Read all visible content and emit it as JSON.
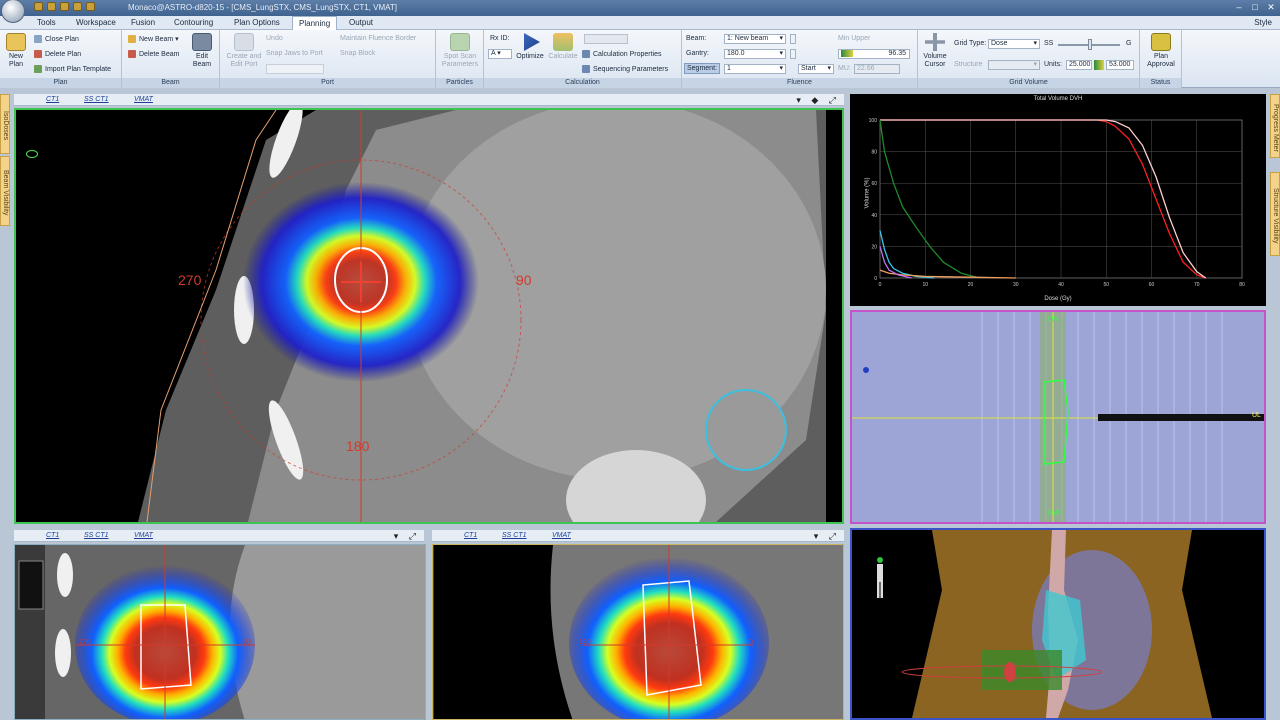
{
  "titlebar": {
    "title": "Monaco@ASTRO-d820-15 - [CMS_LungSTX, CMS_LungSTX, CT1, VMAT]"
  },
  "menu": {
    "items": [
      "Tools",
      "Workspace",
      "Fusion",
      "Contouring",
      "Plan Options",
      "Planning",
      "Output"
    ],
    "active": "Planning",
    "style": "Style"
  },
  "ribbon": {
    "plan": {
      "label": "Plan",
      "new_plan": "New Plan",
      "close_plan": "Close Plan",
      "delete_plan": "Delete Plan",
      "import_template": "Import Plan Template"
    },
    "beam": {
      "label": "Beam",
      "new_beam": "New Beam",
      "delete_beam": "Delete Beam",
      "edit_beam": "Edit Beam"
    },
    "port": {
      "label": "Port",
      "create_edit": "Create and Edit Port",
      "undo": "Undo",
      "snap_jaws": "Snap Jaws to Port",
      "maintain_fluence": "Maintain Fluence Border",
      "snap_block": "Snap Block"
    },
    "particles": {
      "label": "Particles",
      "spot_scan": "Spot Scan Parameters"
    },
    "calculation": {
      "label": "Calculation",
      "rx_id_label": "Rx ID:",
      "rx_id_value": "A",
      "optimize": "Optimize",
      "calculate": "Calculate",
      "calc_props": "Calculation Properties",
      "seq_params": "Sequencing Parameters"
    },
    "fluence": {
      "label": "Fluence",
      "beam_label": "Beam:",
      "beam_value": "1: New beam",
      "gantry_label": "Gantry:",
      "gantry_value": "180.0",
      "segment_label": "Segment:",
      "segment_value": "1",
      "start": "Start",
      "mu_label": "MU:",
      "mu_value": "22.66",
      "min_upper": "Min Upper",
      "min_value": "96.35"
    },
    "grid": {
      "label": "Grid Volume",
      "volume_cursor": "Volume Cursor",
      "grid_type_label": "Grid Type:",
      "grid_type_value": "Dose",
      "ss": "SS",
      "g": "G",
      "structure_label": "Structure",
      "units_label": "Units:",
      "units_low": "25.000",
      "units_high": "53.000"
    },
    "status": {
      "label": "Status",
      "plan_approval": "Plan Approval"
    }
  },
  "views": {
    "axial": {
      "tab1": "CT1",
      "tab2": "SS CT1",
      "tab3": "VMAT",
      "angle_270": "270",
      "angle_90": "90",
      "angle_180": "180"
    },
    "coronal": {
      "tab1": "CT1",
      "tab2": "SS CT1",
      "tab3": "VMAT",
      "angle_270": "270",
      "angle_90": "90"
    },
    "sagittal": {
      "tab1": "CT1",
      "tab2": "SS CT1",
      "tab3": "VMAT",
      "angle_180": "180",
      "angle_0": "0"
    }
  },
  "dvh": {
    "title": "Total Volume DVH",
    "xlabel": "Dose (Gy)",
    "ylabel": "Volume (%)",
    "xticks": [
      "0",
      "10",
      "20",
      "30",
      "40",
      "50",
      "60",
      "70",
      "80"
    ],
    "yticks": [
      "0",
      "20",
      "40",
      "60",
      "80",
      "100"
    ]
  },
  "drr": {
    "top_label": "LW",
    "bottom_label": "RW",
    "right_label": "UL"
  },
  "side_tabs": {
    "left1": "IsoDoses",
    "left2": "Beam Visibility",
    "right1": "Progress Meter",
    "right2": "Structure Visibility"
  },
  "chart_data": {
    "type": "line",
    "title": "Total Volume DVH",
    "xlabel": "Dose (Gy)",
    "ylabel": "Volume (%)",
    "xlim": [
      0,
      80
    ],
    "ylim": [
      0,
      100
    ],
    "series": [
      {
        "color": "#ff2020",
        "x": [
          0,
          48,
          50,
          52,
          55,
          58,
          61,
          64,
          67,
          70,
          72
        ],
        "y": [
          100,
          100,
          99,
          96,
          88,
          72,
          50,
          28,
          10,
          2,
          0
        ]
      },
      {
        "color": "#ffd0d0",
        "x": [
          0,
          50,
          52,
          55,
          58,
          61,
          64,
          67,
          70,
          72
        ],
        "y": [
          100,
          100,
          99,
          95,
          84,
          64,
          38,
          16,
          4,
          0
        ]
      },
      {
        "color": "#1f8a2a",
        "x": [
          0,
          1,
          3,
          5,
          8,
          11,
          14,
          18,
          22
        ],
        "y": [
          100,
          80,
          60,
          45,
          32,
          20,
          10,
          3,
          0
        ]
      },
      {
        "color": "#35c8f0",
        "x": [
          0,
          1,
          2,
          3,
          5,
          8,
          12
        ],
        "y": [
          30,
          18,
          10,
          6,
          3,
          1,
          0
        ]
      },
      {
        "color": "#f0a060",
        "x": [
          0,
          2,
          5,
          10,
          20,
          30
        ],
        "y": [
          5,
          3,
          2,
          1,
          0.5,
          0
        ]
      },
      {
        "color": "#c070f0",
        "x": [
          0,
          1,
          2,
          4,
          7
        ],
        "y": [
          20,
          10,
          5,
          2,
          0
        ]
      }
    ]
  }
}
